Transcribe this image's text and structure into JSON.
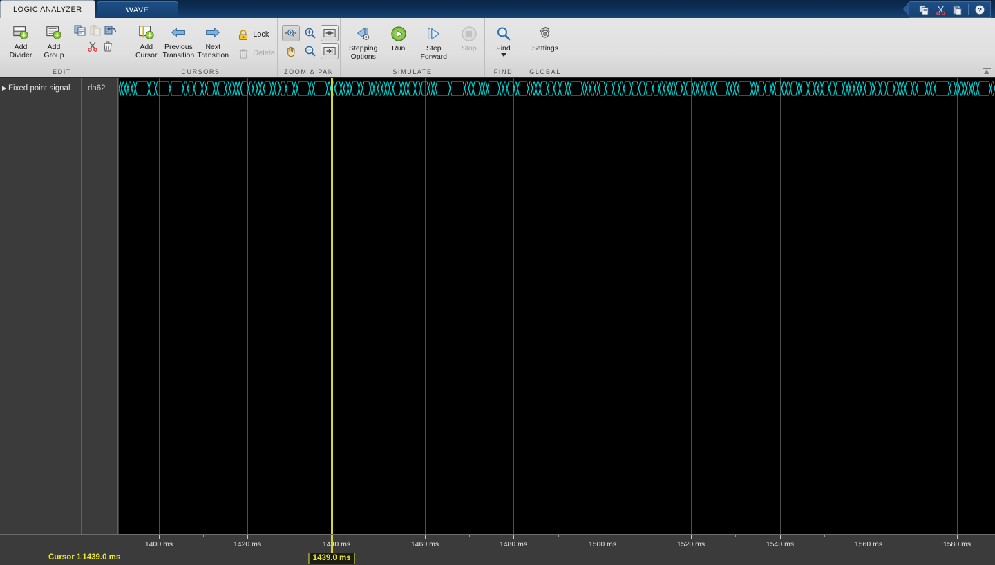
{
  "window": {
    "title": "Logic Analyzer",
    "tabs": [
      {
        "label": "LOGIC ANALYZER",
        "active": true
      },
      {
        "label": "WAVE",
        "active": false
      }
    ],
    "quick_access": [
      {
        "name": "copy-icon",
        "label": "Copy"
      },
      {
        "name": "cut-scissors-icon",
        "label": "Cut"
      },
      {
        "name": "paste-icon",
        "label": "Paste"
      },
      {
        "name": "help-icon",
        "label": "Help"
      }
    ]
  },
  "ribbon": {
    "collapse_label": "Minimize Ribbon",
    "groups": [
      {
        "title": "EDIT",
        "big_buttons": [
          {
            "label": "Add\nDivider",
            "line1": "Add",
            "line2": "Divider",
            "icon": "add-divider-icon",
            "enabled": true
          },
          {
            "label": "Add\nGroup",
            "line1": "Add",
            "line2": "Group",
            "icon": "add-group-icon",
            "enabled": true
          }
        ],
        "small_buttons": [
          {
            "label": "Copy",
            "icon": "copy-icon",
            "enabled": true
          },
          {
            "label": "Paste",
            "icon": "paste-icon",
            "enabled": false
          },
          {
            "label": "Undo",
            "icon": "undo-icon",
            "enabled": true
          },
          {
            "label": "Cut",
            "icon": "cut-icon",
            "enabled": true
          },
          {
            "label": "Delete",
            "icon": "trash-icon",
            "enabled": true
          }
        ]
      },
      {
        "title": "CURSORS",
        "big_buttons": [
          {
            "line1": "Add",
            "line2": "Cursor",
            "icon": "add-cursor-icon",
            "enabled": true
          },
          {
            "line1": "Previous",
            "line2": "Transition",
            "icon": "previous-transition-icon",
            "enabled": true
          },
          {
            "line1": "Next",
            "line2": "Transition",
            "icon": "next-transition-icon",
            "enabled": true
          }
        ],
        "small_buttons": [
          {
            "label": "Lock",
            "icon": "lock-icon",
            "enabled": true
          },
          {
            "label": "Delete",
            "icon": "trash-icon",
            "enabled": false
          }
        ]
      },
      {
        "title": "ZOOM & PAN",
        "tools": [
          {
            "name": "zoom-in-region-icon",
            "selected": true
          },
          {
            "name": "zoom-in-icon",
            "selected": false
          },
          {
            "name": "fit-to-view-icon",
            "selected": false
          },
          {
            "name": "pan-hand-icon",
            "selected": false
          },
          {
            "name": "zoom-out-icon",
            "selected": false
          },
          {
            "name": "zoom-to-end-icon",
            "selected": false
          }
        ]
      },
      {
        "title": "SIMULATE",
        "big_buttons": [
          {
            "line1": "Stepping",
            "line2": "Options",
            "icon": "stepping-options-icon",
            "enabled": true
          },
          {
            "line1": "Run",
            "line2": "",
            "icon": "run-icon",
            "enabled": true
          },
          {
            "line1": "Step",
            "line2": "Forward",
            "icon": "step-forward-icon",
            "enabled": true
          },
          {
            "line1": "Stop",
            "line2": "",
            "icon": "stop-icon",
            "enabled": false
          }
        ]
      },
      {
        "title": "FIND",
        "big_buttons": [
          {
            "line1": "Find",
            "line2": "",
            "icon": "find-icon",
            "enabled": true,
            "has_dropdown": true
          }
        ]
      },
      {
        "title": "GLOBAL",
        "big_buttons": [
          {
            "line1": "Settings",
            "line2": "",
            "icon": "settings-gear-icon",
            "enabled": true
          }
        ]
      }
    ]
  },
  "wave": {
    "signals": [
      {
        "name": "Fixed point signal",
        "value": "da62",
        "expandable": true,
        "color": "#00d4d4"
      }
    ],
    "cursor": {
      "label": "Cursor 1",
      "time_text": "1439.0 ms",
      "badge_text": "1439.0 ms",
      "time_ms": 1439.0,
      "color": "#e9e92a"
    },
    "axis": {
      "unit": "ms",
      "start_ms": 1391.0,
      "end_ms": 1588.5,
      "major_ticks": [
        {
          "value": 1400,
          "label": "1400 ms"
        },
        {
          "value": 1420,
          "label": "1420 ms"
        },
        {
          "value": 1440,
          "label": "1440 ms"
        },
        {
          "value": 1460,
          "label": "1460 ms"
        },
        {
          "value": 1480,
          "label": "1480 ms"
        },
        {
          "value": 1500,
          "label": "1500 ms"
        },
        {
          "value": 1520,
          "label": "1520 ms"
        },
        {
          "value": 1540,
          "label": "1540 ms"
        },
        {
          "value": 1560,
          "label": "1560 ms"
        },
        {
          "value": 1580,
          "label": "1580 ms"
        }
      ],
      "minor_ticks": [
        1390,
        1410,
        1430,
        1450,
        1470,
        1490,
        1510,
        1530,
        1550,
        1570
      ]
    }
  }
}
